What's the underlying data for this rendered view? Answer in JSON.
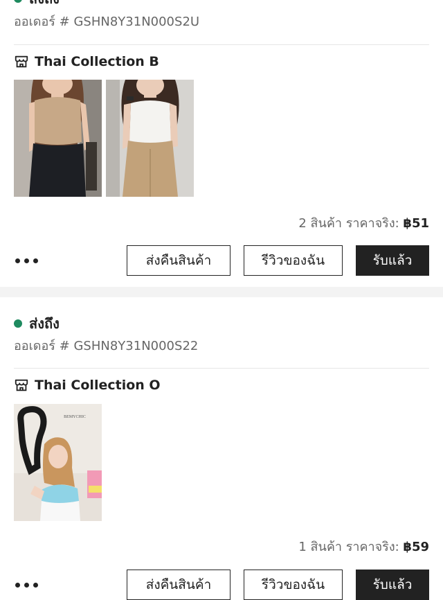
{
  "orders": [
    {
      "status": "ส่งถึง",
      "order_number": "ออเดอร์ # GSHN8Y31N000S2U",
      "store_name": "Thai Collection B",
      "item_count_text": "2 สินค้า ราคาจริง:",
      "price": "฿51",
      "actions": {
        "return_label": "ส่งคืนสินค้า",
        "review_label": "รีวิวของฉัน",
        "received_label": "รับแล้ว"
      }
    },
    {
      "status": "ส่งถึง",
      "order_number": "ออเดอร์ # GSHN8Y31N000S22",
      "store_name": "Thai Collection O",
      "item_count_text": "1 สินค้า ราคาจริง:",
      "price": "฿59",
      "product_image_watermark": "BEMYCHIC",
      "actions": {
        "return_label": "ส่งคืนสินค้า",
        "review_label": "รีวิวของฉัน",
        "received_label": "รับแล้ว"
      }
    }
  ],
  "colors": {
    "status_dot": "#1e8a5f",
    "primary_button": "#222222",
    "section_gap": "#f3f3f3"
  }
}
